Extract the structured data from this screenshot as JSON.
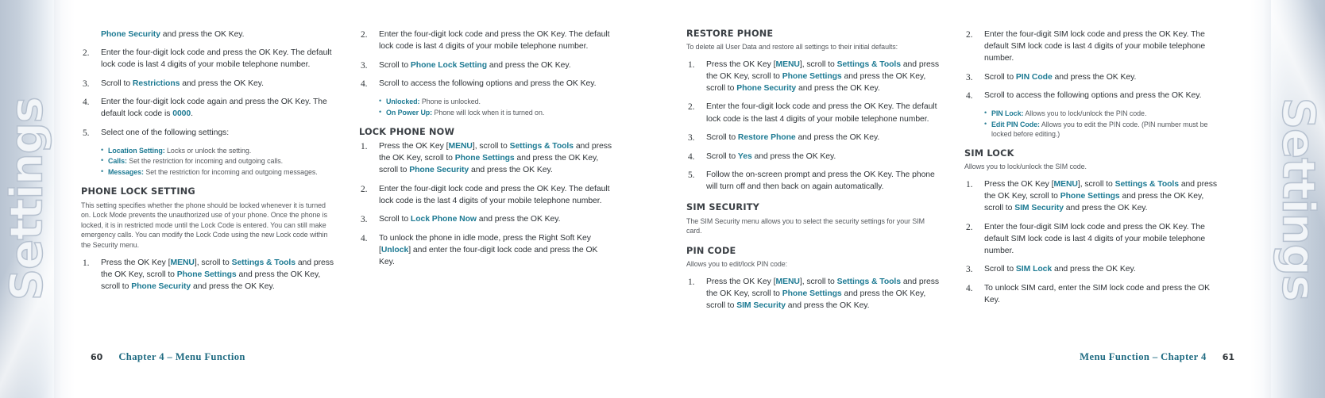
{
  "edges": {
    "left_watermark": "Settings",
    "right_watermark": "Settings"
  },
  "colors": {
    "accent_teal": "#1d7a93",
    "heading_gray": "#3a3f44",
    "runhead_teal": "#1f6b82"
  },
  "left_page": {
    "folio": "60",
    "running_head": "Chapter 4 – Menu Function",
    "column_1": {
      "continued_step": "Phone Security and press the OK Key.",
      "continued_step_link": "Phone Security",
      "steps": [
        {
          "num": "2.",
          "text": "Enter the four-digit lock code and press the OK Key. The default lock code is last 4 digits of your mobile telephone number."
        },
        {
          "num": "3.",
          "text": "Scroll to Restrictions and press the OK Key.",
          "link": "Restrictions"
        },
        {
          "num": "4.",
          "text": "Enter the four-digit lock code again and press the OK Key. The default lock code is 0000.",
          "link": "0000"
        },
        {
          "num": "5.",
          "text": "Select one of the following settings:"
        }
      ],
      "bullets": [
        {
          "term": "Location Setting:",
          "desc": " Locks or unlock the setting."
        },
        {
          "term": "Calls:",
          "desc": " Set the restriction for incoming and outgoing calls."
        },
        {
          "term": "Messages:",
          "desc": " Set the restriction for incoming and outgoing messages."
        }
      ],
      "heading": "PHONE LOCK SETTING",
      "intro": "This setting specifies whether the phone should be locked whenever it is turned on. Lock Mode prevents the unauthorized use of your phone. Once the phone is locked, it is in restricted mode until the Lock Code is entered. You can still make emergency calls. You can modify the Lock Code using the new Lock code within the Security menu.",
      "step_1": {
        "num": "1.",
        "text": "Press the OK Key [MENU], scroll to Settings & Tools and press the OK Key, scroll to Phone Settings and press the OK Key, scroll to Phone Security and press the OK Key."
      }
    },
    "column_2": {
      "steps": [
        {
          "num": "2.",
          "text": "Enter the four-digit lock code and press the OK Key. The default lock code is last 4 digits of your mobile telephone number."
        },
        {
          "num": "3.",
          "text": "Scroll to Phone Lock Setting and press the OK Key.",
          "link": "Phone Lock Setting"
        },
        {
          "num": "4.",
          "text": "Scroll to access the following options and press the OK Key."
        }
      ],
      "bullets": [
        {
          "term": "Unlocked:",
          "desc": " Phone is unlocked."
        },
        {
          "term": "On Power Up:",
          "desc": " Phone will lock when it is turned on."
        }
      ],
      "heading": "LOCK PHONE NOW",
      "steps_2": [
        {
          "num": "1.",
          "text": "Press the OK Key [MENU], scroll to Settings & Tools and press the OK Key, scroll to Phone Settings and press the OK Key, scroll to Phone Security and press the OK Key."
        },
        {
          "num": "2.",
          "text": "Enter the four-digit lock code and press the OK Key. The default lock code is the last 4 digits of your mobile telephone number."
        },
        {
          "num": "3.",
          "text": "Scroll to Lock Phone Now and press the OK Key.",
          "link": "Lock Phone Now"
        },
        {
          "num": "4.",
          "text": "To unlock the phone in idle mode, press the Right Soft Key [Unlock] and enter the four-digit lock code and press the OK Key."
        }
      ]
    }
  },
  "right_page": {
    "folio": "61",
    "running_head": "Menu Function – Chapter 4",
    "column_1": {
      "heading": "RESTORE PHONE",
      "intro": "To delete all User Data and restore all settings to their initial defaults:",
      "steps": [
        {
          "num": "1.",
          "text": "Press the OK Key [MENU], scroll to Settings & Tools and press the OK Key, scroll to Phone Settings and press the OK Key, scroll to Phone Security and press the OK Key."
        },
        {
          "num": "2.",
          "text": "Enter the four-digit lock code and press the OK Key. The default lock code is the last 4 digits of your mobile telephone number."
        },
        {
          "num": "3.",
          "text": "Scroll to Restore Phone and press the OK Key.",
          "link": "Restore Phone"
        },
        {
          "num": "4.",
          "text": "Scroll to Yes and press the OK Key.",
          "link": "Yes"
        },
        {
          "num": "5.",
          "text": "Follow the on-screen prompt and press the OK Key. The phone will turn off and then back on again automatically."
        }
      ],
      "heading_2": "SIM SECURITY",
      "intro_2": "The SIM Security menu allows you to select the security settings for your SIM card.",
      "heading_3": "PIN CODE",
      "intro_3": "Allows you to edit/lock PIN code:",
      "step_1": {
        "num": "1.",
        "text": "Press the OK Key [MENU], scroll to Settings & Tools and press the OK Key, scroll to Phone Settings and press the OK Key, scroll to SIM Security and press the OK Key."
      }
    },
    "column_2": {
      "steps": [
        {
          "num": "2.",
          "text": "Enter the four-digit SIM lock code and press the OK Key. The default SIM lock code is last 4 digits of your mobile telephone number."
        },
        {
          "num": "3.",
          "text": "Scroll to PIN Code and press the OK Key.",
          "link": "PIN Code"
        },
        {
          "num": "4.",
          "text": "Scroll to access the following options and press the OK Key."
        }
      ],
      "bullets": [
        {
          "term": "PIN Lock:",
          "desc": " Allows you to lock/unlock the PIN code."
        },
        {
          "term": "Edit PIN Code:",
          "desc": " Allows you to edit the PIN code. (PIN number must be locked before editing.)"
        }
      ],
      "heading": "SIM LOCK",
      "intro": "Allows you to lock/unlock the SIM code.",
      "steps_2": [
        {
          "num": "1.",
          "text": "Press the OK Key [MENU], scroll to Settings & Tools and press the OK Key, scroll to Phone Settings and press the OK Key, scroll to SIM Security and press the OK Key."
        },
        {
          "num": "2.",
          "text": "Enter the four-digit SIM lock code and press the OK Key. The default SIM lock code is last 4 digits of your mobile telephone number."
        },
        {
          "num": "3.",
          "text": "Scroll to SIM Lock and press the OK Key.",
          "link": "SIM Lock"
        },
        {
          "num": "4.",
          "text": "To unlock SIM card, enter the SIM lock code and press the OK Key."
        }
      ]
    }
  }
}
